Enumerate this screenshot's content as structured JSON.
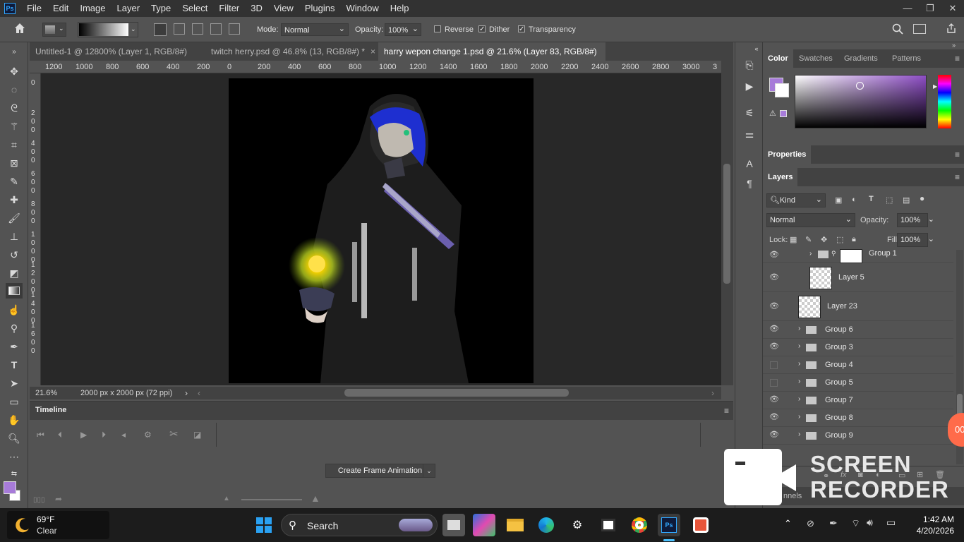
{
  "app": {
    "logo_text": "Ps",
    "menu": [
      "File",
      "Edit",
      "Image",
      "Layer",
      "Type",
      "Select",
      "Filter",
      "3D",
      "View",
      "Plugins",
      "Window",
      "Help"
    ],
    "window_controls": [
      "—",
      "❐",
      "✕"
    ]
  },
  "options_bar": {
    "mode_label": "Mode:",
    "mode_value": "Normal",
    "opacity_label": "Opacity:",
    "opacity_value": "100%",
    "reverse_label": "Reverse",
    "reverse_checked": false,
    "dither_label": "Dither",
    "dither_checked": true,
    "transparency_label": "Transparency",
    "transparency_checked": true
  },
  "tabs": [
    {
      "label": "Untitled-1 @ 12800% (Layer 1, RGB/8#) *",
      "active": false
    },
    {
      "label": "twitch herry.psd @ 46.8% (13, RGB/8#) *",
      "active": false
    },
    {
      "label": "harry wepon change 1.psd @ 21.6% (Layer 83, RGB/8#) *",
      "active": true
    }
  ],
  "ruler": {
    "h_labels": [
      "1200",
      "1000",
      "800",
      "600",
      "400",
      "200",
      "0",
      "200",
      "400",
      "600",
      "800",
      "1000",
      "1200",
      "1400",
      "1600",
      "1800",
      "2000",
      "2200",
      "2400",
      "2600",
      "2800",
      "3000",
      "3"
    ],
    "v_labels": [
      "0",
      "2\n0\n0",
      "4\n0\n0",
      "6\n0\n0",
      "8\n0\n0",
      "1\n0\n0\n0",
      "1\n2\n0\n0",
      "1\n4\n0\n0",
      "1\n6\n0\n0"
    ]
  },
  "status": {
    "zoom": "21.6%",
    "doc_size": "2000 px x 2000 px (72 ppi)"
  },
  "timeline": {
    "title": "Timeline",
    "create_button": "Create Frame Animation"
  },
  "color_panel": {
    "tabs": [
      "Color",
      "Swatches",
      "Gradients",
      "Patterns"
    ],
    "fg_color": "#a77bd9",
    "bg_color": "#ffffff"
  },
  "properties_panel": {
    "title": "Properties"
  },
  "layers_panel": {
    "title": "Layers",
    "filter_label": "Kind",
    "blend_mode": "Normal",
    "opacity_label": "Opacity:",
    "opacity_value": "100%",
    "lock_label": "Lock:",
    "fill_label": "Fill:",
    "fill_value": "100%",
    "layers": [
      {
        "name": "Group 1",
        "type": "group-linked",
        "visible": true
      },
      {
        "name": "Layer 5",
        "type": "pixel",
        "visible": true
      },
      {
        "name": "Layer 23",
        "type": "pixel",
        "visible": true
      },
      {
        "name": "Group 6",
        "type": "group",
        "visible": true
      },
      {
        "name": "Group 3",
        "type": "group",
        "visible": true
      },
      {
        "name": "Group 4",
        "type": "group",
        "visible": false
      },
      {
        "name": "Group 5",
        "type": "group",
        "visible": false
      },
      {
        "name": "Group 7",
        "type": "group",
        "visible": true
      },
      {
        "name": "Group 8",
        "type": "group",
        "visible": true
      },
      {
        "name": "Group 9",
        "type": "group",
        "visible": true
      }
    ],
    "bottom_tabs": [
      "nnels"
    ]
  },
  "watermark": {
    "line1": "SCREEN",
    "line2": "RECORDER",
    "badge": "00"
  },
  "taskbar": {
    "weather_temp": "69°F",
    "weather_desc": "Clear",
    "search_label": "Search",
    "time": "1:42 AM",
    "date": "4/20/2026"
  }
}
